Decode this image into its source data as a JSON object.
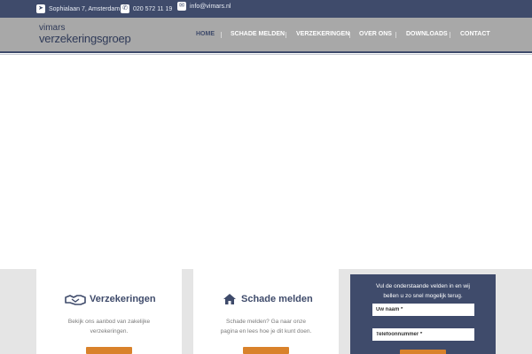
{
  "topbar": {
    "address": "Sophialaan 7, Amsterdam",
    "phone": "020 572 11 19",
    "email": "info@vimars.nl"
  },
  "logo": {
    "line1": "vimars",
    "line2": "verzekeringsgroep"
  },
  "nav": {
    "items": [
      "HOME",
      "SCHADE MELDEN",
      "VERZEKERINGEN",
      "OVER ONS",
      "DOWNLOADS",
      "CONTACT"
    ]
  },
  "cards": [
    {
      "title": "Verzekeringen",
      "text1": "Bekijk ons aanbod van zakelijke",
      "text2": "verzekeringen."
    },
    {
      "title": "Schade melden",
      "text1": "Schade melden? Ga naar onze",
      "text2": "pagina en lees hoe je dit kunt doen."
    }
  ],
  "form": {
    "text1": "Vul de onderstaande velden in en wij",
    "text2": "bellen u zo snel mogelijk terug.",
    "name_placeholder": "Uw naam *",
    "phone_placeholder": "Telefoonnummer *"
  },
  "colors": {
    "navy": "#3f4b6b",
    "orange": "#d9822b",
    "gray": "#a8a8a8"
  }
}
